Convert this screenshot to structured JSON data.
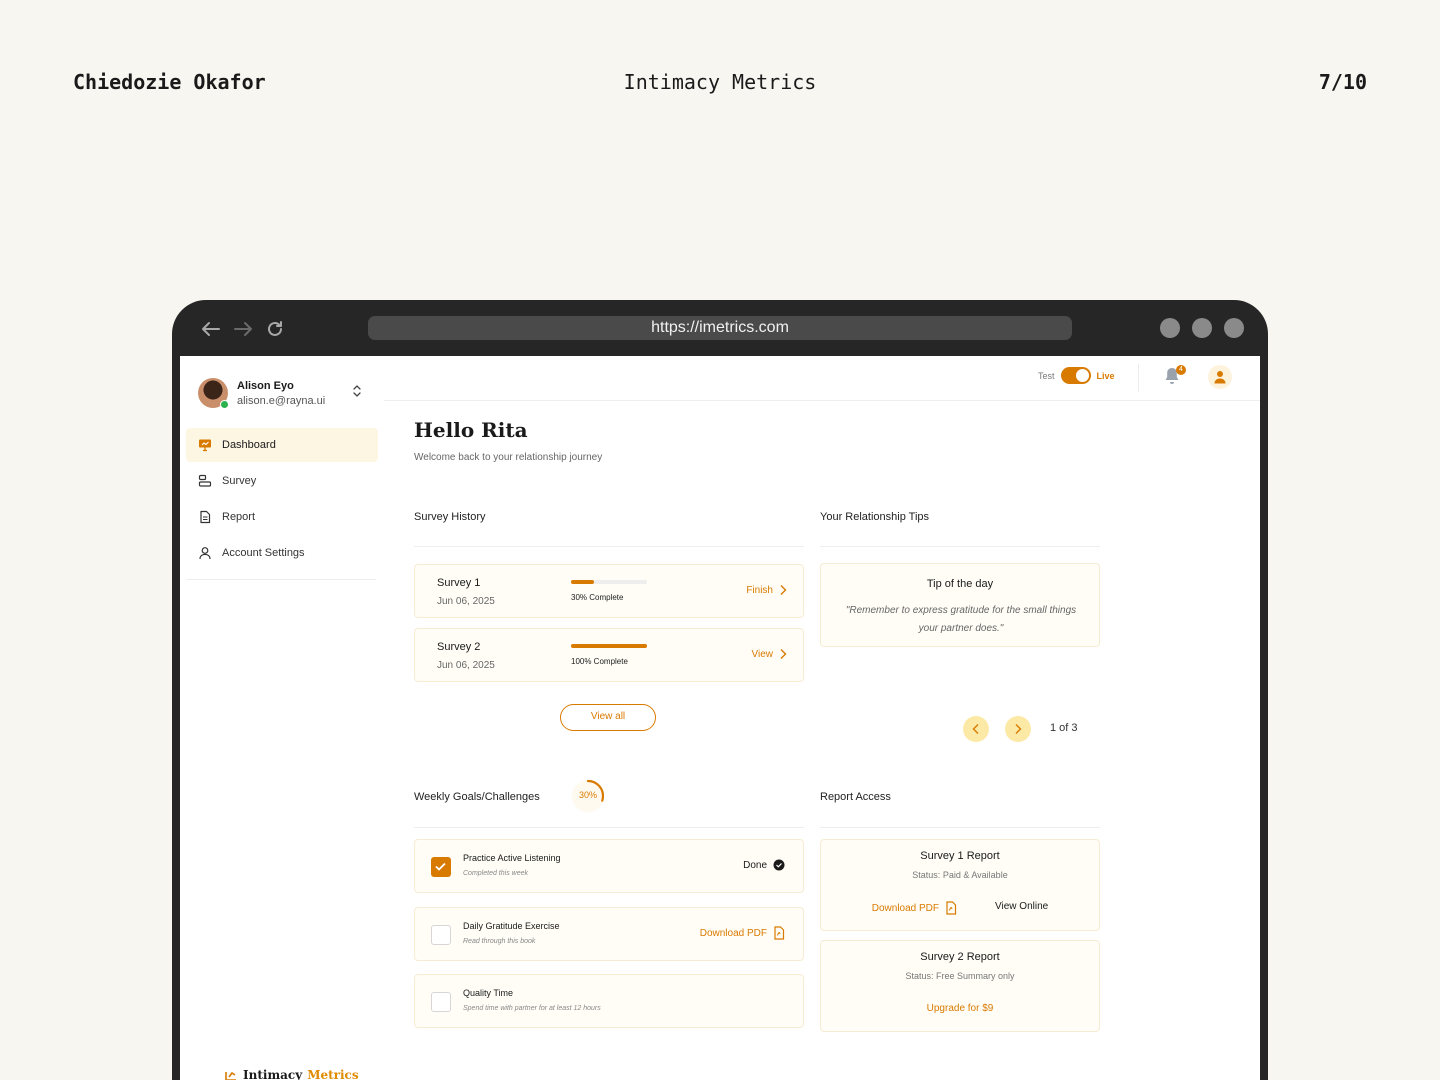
{
  "page": {
    "author": "Chiedozie Okafor",
    "title": "Intimacy Metrics",
    "pager": "7/10"
  },
  "browser": {
    "url": "https://imetrics.com"
  },
  "user": {
    "name": "Alison Eyo",
    "email": "alison.e@rayna.ui"
  },
  "sidebar": {
    "items": [
      {
        "label": "Dashboard",
        "icon": "presentation-icon",
        "active": true
      },
      {
        "label": "Survey",
        "icon": "survey-icon",
        "active": false
      },
      {
        "label": "Report",
        "icon": "document-icon",
        "active": false
      },
      {
        "label": "Account Settings",
        "icon": "user-icon",
        "active": false
      }
    ],
    "logo_text": "Intimacy",
    "logo_accent": "Metrics"
  },
  "header": {
    "mode_test": "Test",
    "mode_live": "Live",
    "notification_count": "4"
  },
  "main": {
    "greeting": "Hello Rita",
    "welcome": "Welcome back to your relationship journey"
  },
  "survey_history": {
    "title": "Survey History",
    "surveys": [
      {
        "name": "Survey 1",
        "date": "Jun 06, 2025",
        "progress_pct": 30,
        "progress_label": "30% Complete",
        "action": "Finish"
      },
      {
        "name": "Survey 2",
        "date": "Jun 06, 2025",
        "progress_pct": 100,
        "progress_label": "100% Complete",
        "action": "View"
      }
    ],
    "view_all": "View all"
  },
  "tips": {
    "title": "Your Relationship Tips",
    "card_title": "Tip of the day",
    "quote": "\"Remember to express gratitude for the small things your partner does.\"",
    "page": "1 of 3"
  },
  "goals": {
    "title": "Weekly Goals/Challenges",
    "progress_label": "30%",
    "progress_fraction": 0.3,
    "items": [
      {
        "name": "Practice Active Listening",
        "sub": "Completed this week",
        "checked": true,
        "action": "Done"
      },
      {
        "name": "Daily Gratitude Exercise",
        "sub": "Read through this book",
        "checked": false,
        "action": "Download PDF"
      },
      {
        "name": "Quality Time",
        "sub": "Spend time with partner for at least 12 hours",
        "checked": false,
        "action": ""
      }
    ]
  },
  "reports": {
    "title": "Report Access",
    "items": [
      {
        "title": "Survey 1 Report",
        "status": "Status: Paid & Available",
        "download": "Download PDF",
        "view": "View Online"
      },
      {
        "title": "Survey 2 Report",
        "status": "Status: Free Summary only",
        "upgrade": "Upgrade for $9"
      }
    ]
  },
  "colors": {
    "accent": "#d97a00",
    "card_bg": "#fffdf6",
    "page_bg": "#f7f6f1",
    "frame": "#262626"
  }
}
